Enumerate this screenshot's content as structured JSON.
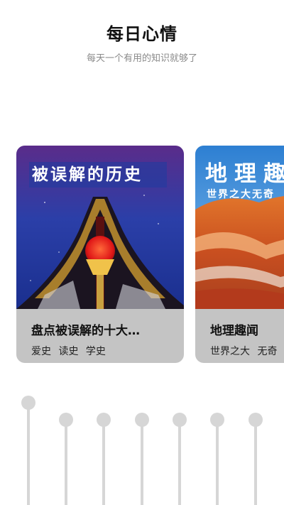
{
  "header": {
    "title": "每日心情",
    "subtitle": "每天一个有用的知识就够了"
  },
  "cards": [
    {
      "cover_text": "被误解的历史",
      "name": "盘点被误解的十大…",
      "tags": [
        "爱史",
        "读史",
        "学史"
      ]
    },
    {
      "cover_text": "地理趣",
      "cover_subtext": "世界之大无奇",
      "name": "地理趣闻",
      "tags": [
        "世界之大",
        "无奇"
      ]
    }
  ],
  "sliders": {
    "count": 7,
    "levels": [
      0.9,
      0.7,
      0.7,
      0.7,
      0.7,
      0.7,
      0.7
    ],
    "color": "#d6d6d6"
  }
}
